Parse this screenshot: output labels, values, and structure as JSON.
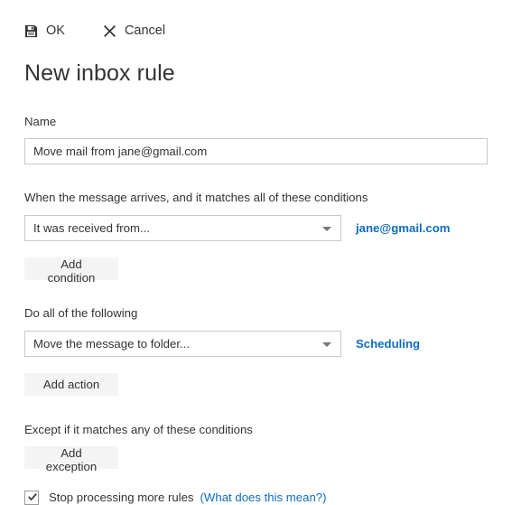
{
  "commands": {
    "ok": {
      "label": "OK",
      "icon": "save-floppy-icon"
    },
    "cancel": {
      "label": "Cancel",
      "icon": "close-x-icon"
    }
  },
  "title": "New inbox rule",
  "name_section": {
    "label": "Name",
    "value": "Move mail from jane@gmail.com",
    "placeholder": ""
  },
  "conditions_section": {
    "label": "When the message arrives, and it matches all of these conditions",
    "select_value": "It was received from...",
    "value_link": "jane@gmail.com",
    "add_button": "Add condition"
  },
  "actions_section": {
    "label": "Do all of the following",
    "select_value": "Move the message to folder...",
    "value_link": "Scheduling",
    "add_button": "Add action"
  },
  "exceptions_section": {
    "label": "Except if it matches any of these conditions",
    "add_button": "Add exception"
  },
  "stop_processing": {
    "label": "Stop processing more rules",
    "help_link": "(What does this mean?)",
    "checked": "true"
  },
  "colors": {
    "link_blue": "#0f6cbd",
    "text": "#333333",
    "button_bg": "#f4f4f4",
    "border": "#c8c8c8"
  }
}
